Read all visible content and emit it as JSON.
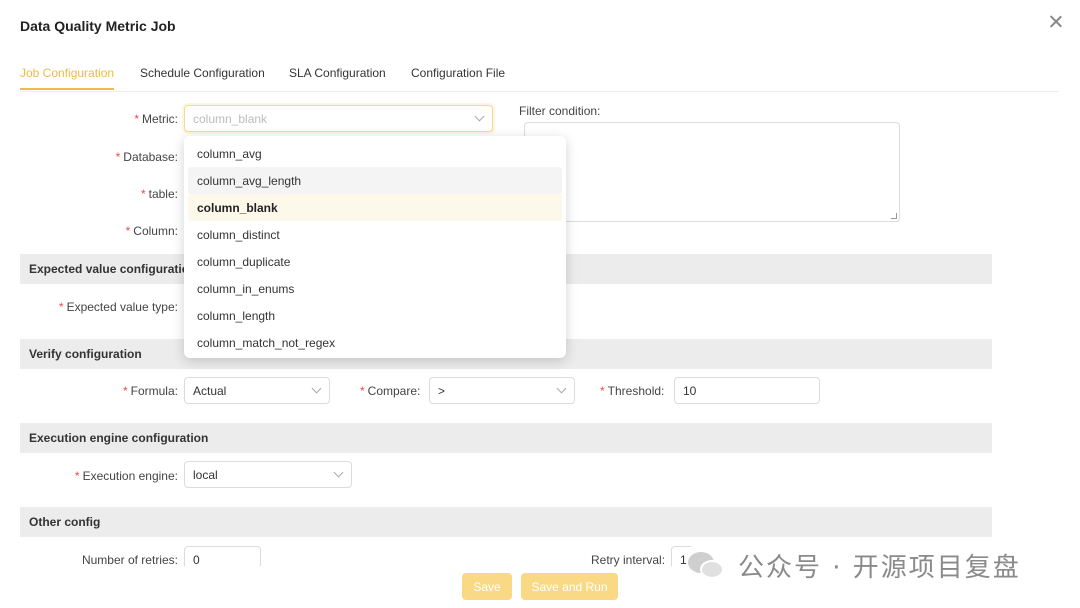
{
  "modal": {
    "title": "Data Quality Metric Job"
  },
  "tabs": [
    {
      "label": "Job Configuration"
    },
    {
      "label": "Schedule Configuration"
    },
    {
      "label": "SLA Configuration"
    },
    {
      "label": "Configuration File"
    }
  ],
  "form": {
    "required_mark": "*",
    "metric": {
      "label": "Metric",
      "value": "column_blank"
    },
    "database": {
      "label": "Database"
    },
    "table": {
      "label": "table"
    },
    "column": {
      "label": "Column"
    },
    "filter_condition": {
      "label": "Filter condition:",
      "value": ""
    },
    "colon": ":"
  },
  "metric_options": [
    "column_avg",
    "column_avg_length",
    "column_blank",
    "column_distinct",
    "column_duplicate",
    "column_in_enums",
    "column_length",
    "column_match_not_regex"
  ],
  "sections": {
    "expected": {
      "title": "Expected value configuration",
      "type_label": "Expected value type"
    },
    "verify": {
      "title": "Verify configuration",
      "formula_label": "Formula",
      "formula_value": "Actual",
      "compare_label": "Compare",
      "compare_value": ">",
      "threshold_label": "Threshold",
      "threshold_value": "10"
    },
    "engine": {
      "title": "Execution engine configuration",
      "engine_label": "Execution engine",
      "engine_value": "local"
    },
    "other": {
      "title": "Other config",
      "retries_label": "Number of retries",
      "retries_value": "0",
      "interval_label": "Retry interval",
      "interval_value": "1"
    }
  },
  "buttons": {
    "save": "Save",
    "save_and_run": "Save and Run"
  },
  "watermark": {
    "text": "公众号 · 开源项目复盘"
  },
  "colors": {
    "accent": "#f2b84b",
    "button": "#fad986",
    "required": "#e84b4b",
    "section_bg": "#ececec"
  }
}
